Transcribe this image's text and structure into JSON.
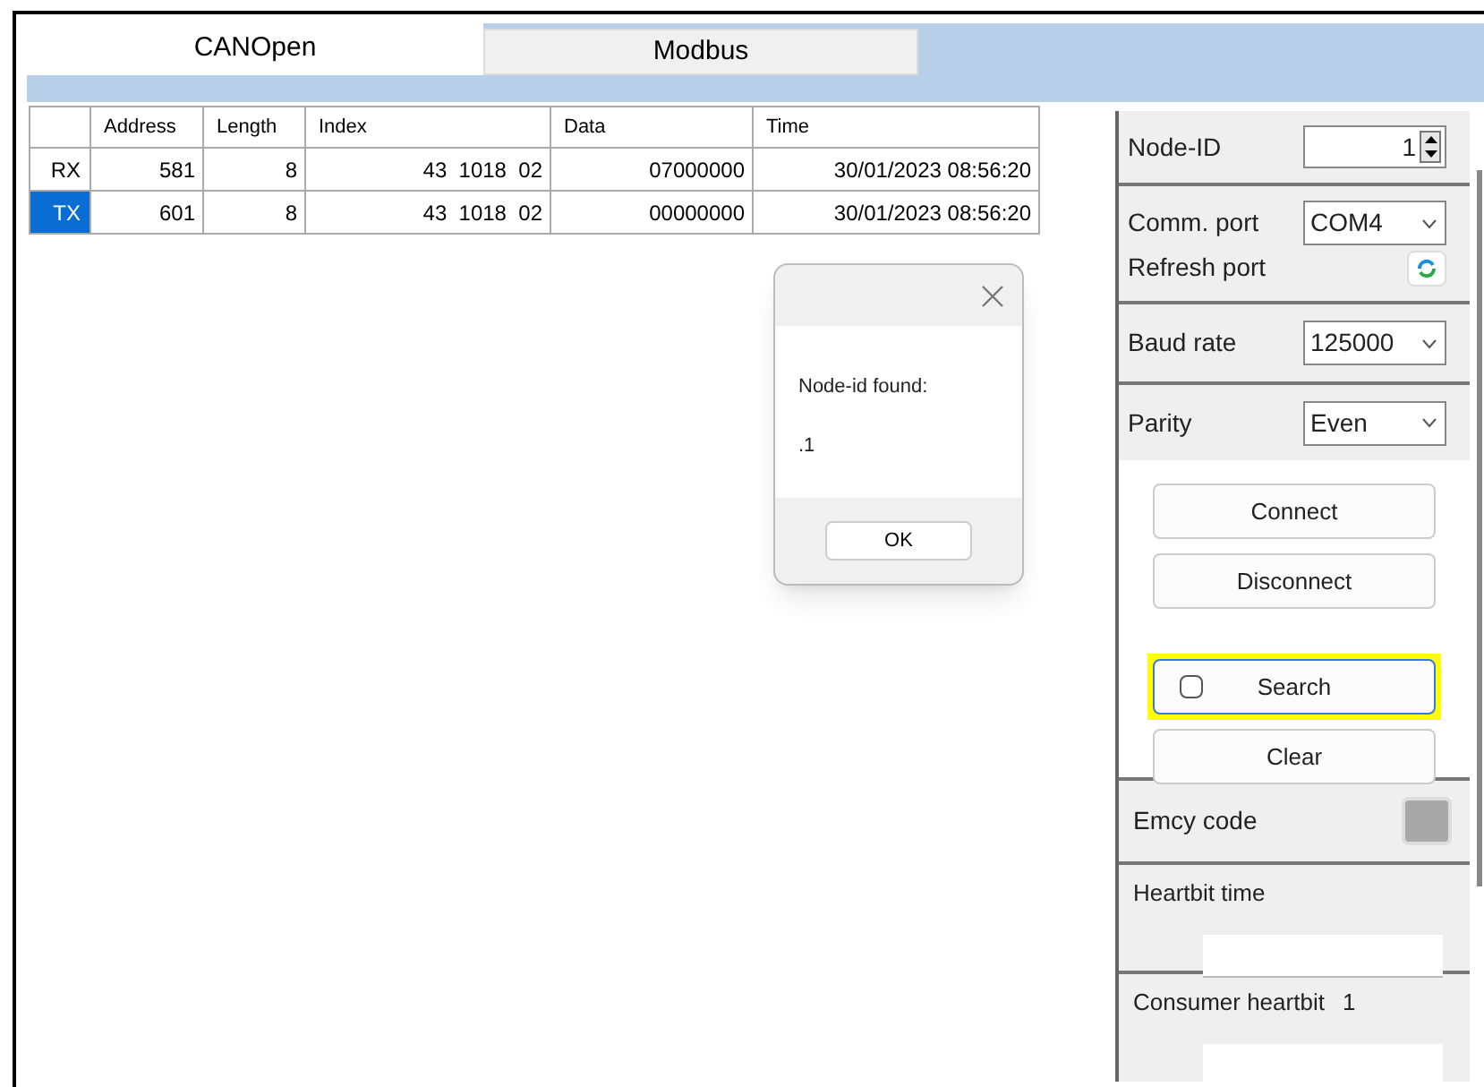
{
  "tabs": [
    {
      "label": "CANOpen",
      "selected": true
    },
    {
      "label": "Modbus",
      "selected": false
    }
  ],
  "table": {
    "columns": [
      "Address",
      "Length",
      "Index",
      "Data",
      "Time"
    ],
    "rows": [
      {
        "header": "RX",
        "selected": false,
        "cells": [
          "581",
          "8",
          "43  1018  02",
          "07000000",
          "30/01/2023 08:56:20"
        ]
      },
      {
        "header": "TX",
        "selected": true,
        "cells": [
          "601",
          "8",
          "43  1018  02",
          "00000000",
          "30/01/2023 08:56:20"
        ]
      }
    ]
  },
  "dialog": {
    "message": "Node-id found:",
    "value": ".1",
    "button": "OK"
  },
  "panel": {
    "node_id": {
      "label": "Node-ID",
      "value": "1"
    },
    "comm_port": {
      "label": "Comm. port",
      "value": "COM4"
    },
    "refresh_port": {
      "label": "Refresh port"
    },
    "baud_rate": {
      "label": "Baud rate",
      "value": "125000"
    },
    "parity": {
      "label": "Parity",
      "value": "Even"
    },
    "buttons": [
      {
        "label": "Connect",
        "kind": "plain",
        "highlighted": false
      },
      {
        "label": "Disconnect",
        "kind": "plain",
        "highlighted": false
      },
      {
        "label": "Search",
        "kind": "checkbox",
        "checked": false,
        "highlighted": true
      },
      {
        "label": "Clear",
        "kind": "plain",
        "highlighted": false
      }
    ],
    "emcy_code": {
      "label": "Emcy code"
    },
    "heartbit_time": {
      "label": "Heartbit time"
    },
    "consumer_heartbit": {
      "label": "Consumer heartbit",
      "value": "1"
    }
  }
}
